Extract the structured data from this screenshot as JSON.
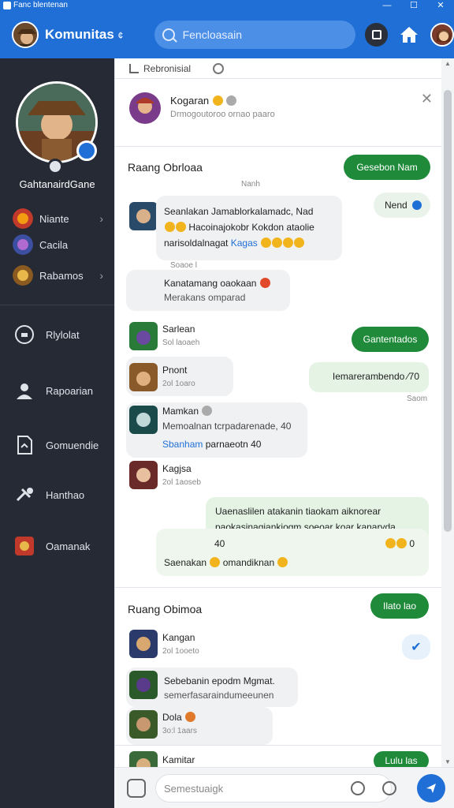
{
  "window": {
    "title": "Fanc blentenan",
    "minimize": "—",
    "maximize": "☐",
    "close": "✕"
  },
  "header": {
    "brand": "Komunitas",
    "brand_suffix": "¢",
    "search_placeholder": "Fencloasain"
  },
  "sidebar": {
    "profile_name": "GahtanairdGane",
    "items": [
      {
        "label": "Niante"
      },
      {
        "label": "Cacila"
      },
      {
        "label": "Rabamos"
      }
    ],
    "nav": [
      {
        "label": "Rlylolat"
      },
      {
        "label": "Rapoarian"
      },
      {
        "label": "Gomuendie"
      },
      {
        "label": "Hanthao"
      },
      {
        "label": "Oamanak"
      }
    ]
  },
  "main": {
    "topbar_label": "Rebronisial",
    "notification": {
      "title": "Kogaran",
      "subtitle": "Drmogoutoroo ornao paaro"
    },
    "section1": {
      "title": "Raang Obrloaa",
      "time": "Nanh",
      "pill_right": "Gesebon Nam",
      "tag_right": "Nend",
      "messages": [
        {
          "line1": "Seanlakan Jamablorkalamadc, Nad",
          "line2": "Hacoinajokobr Kokdon ataolie",
          "line3a": "narisoldalnagat",
          "line3b": "Kagas",
          "time": "Soaoe l"
        },
        {
          "name": "Kanatamang oaokaan",
          "sub": "Merakans omparad"
        },
        {
          "name": "Sarlean",
          "time": "Sol laoaeh",
          "pill": "Gantentados"
        },
        {
          "name": "Pnont",
          "time": "2ol 1oaro",
          "green": "Iemarerambendo ∕70",
          "green_time": "Saom"
        },
        {
          "name": "Mamkan",
          "line1": "Memoalnan tcrpadarenade, 40",
          "line2a": "Sbanham",
          "line2b": "parnaeotn 40"
        },
        {
          "name": "Kagjsa",
          "time": "2ol 1aoseb"
        }
      ],
      "long_green": {
        "line1": "Uaenaslilen atakanin tiaokam aiknorear",
        "line2": "paokasinagiankiogm soeoar koar kanaryda",
        "line3": "40",
        "line4": "Saenakan",
        "line4b": "omandiknan"
      }
    },
    "section2": {
      "title": "Ruang Obimoa",
      "pill_right": "Ilato lao",
      "messages": [
        {
          "name": "Kangan",
          "time": "2ol 1ooeto"
        },
        {
          "line1": "Sebebanin epodm Mgmat.",
          "line2": "semerfasaraindumeeunen"
        },
        {
          "name": "Dola",
          "time": "3o:l 1aars"
        },
        {
          "name": "Kamitar",
          "pill": "Lulu las"
        }
      ]
    }
  },
  "composer": {
    "placeholder": "Semestuaigk"
  }
}
